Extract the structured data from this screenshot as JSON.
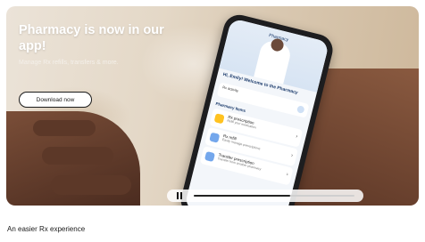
{
  "hero": {
    "headline": "Pharmacy is now in our app!",
    "subline": "Manage Rx refills, transfers & more.",
    "button_label": "Download now"
  },
  "phone_screen": {
    "title": "Pharmacy",
    "welcome": "Hi, Emily! Welcome to the Pharmacy",
    "card_title": "Rx activity",
    "list_title": "Pharmacy Items",
    "rows": [
      {
        "title": "Rx prescription",
        "sub": "Refill your medication"
      },
      {
        "title": "Rx refill",
        "sub": "Easily manage prescriptions"
      },
      {
        "title": "Transfer prescription",
        "sub": "Transfer from another pharmacy"
      }
    ]
  },
  "video": {
    "progress_fraction": 0.6,
    "control_icon": "pause-icon"
  },
  "caption": "An easier Rx experience",
  "colors": {
    "button_bg": "#ffffff",
    "headline": "#ffffff",
    "accent_yellow": "#ffc220",
    "accent_blue": "#74a7ec"
  }
}
